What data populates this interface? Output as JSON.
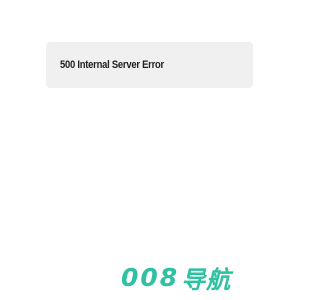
{
  "error": {
    "message": "500 Internal Server Error"
  },
  "brand": {
    "digits": "008",
    "name": "导航",
    "color": "#2ec1a2"
  }
}
